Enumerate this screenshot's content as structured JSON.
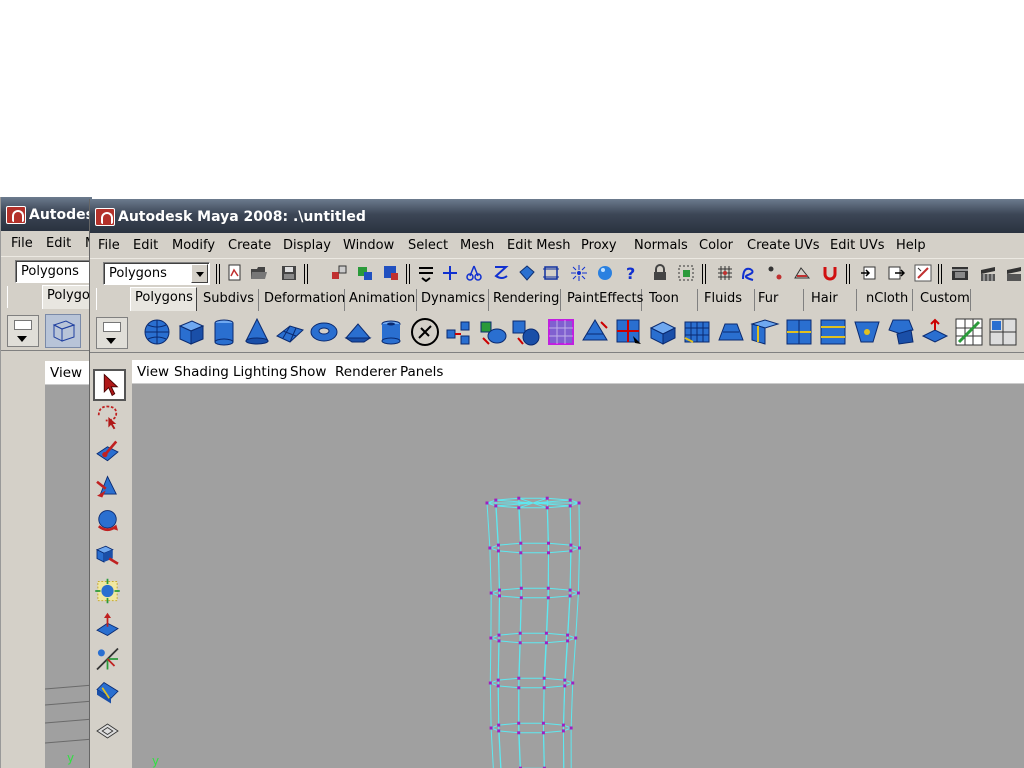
{
  "back_window": {
    "title": "Autodesk Maya 2008: .\\untitled",
    "menu": [
      "File",
      "Edit",
      "M"
    ],
    "menuset": "Polygons",
    "shelf_tab": "Polygons",
    "panel_menu": [
      "View"
    ]
  },
  "front_window": {
    "title": "Autodesk Maya 2008: .\\untitled",
    "menu": [
      "File",
      "Edit",
      "Modify",
      "Create",
      "Display",
      "Window",
      "Select",
      "Mesh",
      "Edit Mesh",
      "Proxy",
      "Normals",
      "Color",
      "Create UVs",
      "Edit UVs",
      "Help"
    ],
    "menuset": "Polygons",
    "shelf_tabs": [
      "Polygons",
      "Subdivs",
      "Deformation",
      "Animation",
      "Dynamics",
      "Rendering",
      "PaintEffects",
      "Toon",
      "Fluids",
      "Fur",
      "Hair",
      "nCloth",
      "Custom"
    ],
    "active_shelf_tab": "Polygons",
    "panel_menu": [
      "View",
      "Shading",
      "Lighting",
      "Show",
      "Renderer",
      "Panels"
    ],
    "shelf_icons": [
      "poly-sphere-icon",
      "poly-cube-icon",
      "poly-cylinder-icon",
      "poly-cone-icon",
      "poly-plane-icon",
      "poly-torus-icon",
      "poly-prism-icon",
      "poly-pipe-icon",
      "poly-helix-icon",
      "combine-icon",
      "separate-icon",
      "extract-icon",
      "smooth-icon",
      "boolean-icon",
      "cut-faces-icon",
      "extrude-icon",
      "bridge-icon",
      "append-icon",
      "split-icon",
      "insert-edge-loop-icon",
      "offset-edge-loop-icon",
      "merge-icon",
      "duplicate-face-icon",
      "create-polygon-icon",
      "sculpt-icon",
      "uv-editor-icon"
    ],
    "tools": [
      "select-tool-icon",
      "lasso-tool-icon",
      "paint-select-tool-icon",
      "move-tool-icon",
      "rotate-tool-icon",
      "scale-tool-icon",
      "universal-manip-icon",
      "soft-mod-icon",
      "show-manip-icon",
      "last-tool-icon",
      "single-perspective-icon"
    ],
    "axis_label": "y"
  },
  "colors": {
    "viewport_bg": "#a0a0a0",
    "wireframe": "#5ee8f0",
    "vertex": "#a020c0",
    "titlebar": "#3c4656"
  }
}
